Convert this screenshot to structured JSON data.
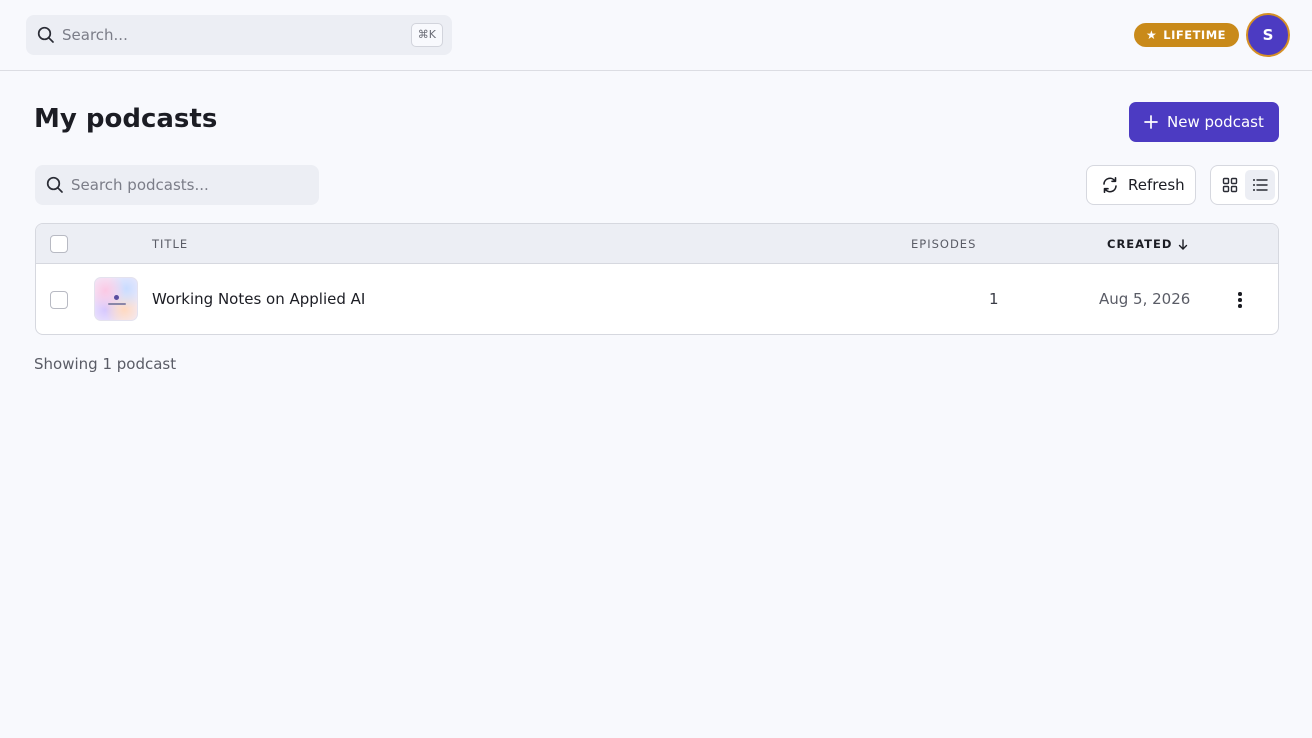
{
  "topbar": {
    "search_placeholder": "Search...",
    "shortcut": "⌘K",
    "badge_label": "LIFETIME",
    "avatar_initial": "S"
  },
  "page": {
    "title": "My podcasts",
    "new_button_label": "New podcast",
    "search_placeholder": "Search podcasts...",
    "refresh_label": "Refresh"
  },
  "table": {
    "columns": {
      "title": "TITLE",
      "episodes": "EPISODES",
      "created": "CREATED"
    },
    "rows": [
      {
        "title": "Working Notes on Applied AI",
        "episodes": "1",
        "created": "Aug 5, 2026"
      }
    ]
  },
  "footer": {
    "count_text": "Showing 1 podcast"
  },
  "colors": {
    "accent": "#4c3bc2",
    "badge": "#c98a1a",
    "background": "#f8f9fd"
  },
  "icons": {
    "search": "search-icon",
    "star": "star-icon",
    "plus": "plus-icon",
    "refresh": "refresh-icon",
    "grid": "grid-view-icon",
    "list": "list-view-icon",
    "sort": "arrow-down-icon",
    "more": "more-vertical-icon"
  }
}
